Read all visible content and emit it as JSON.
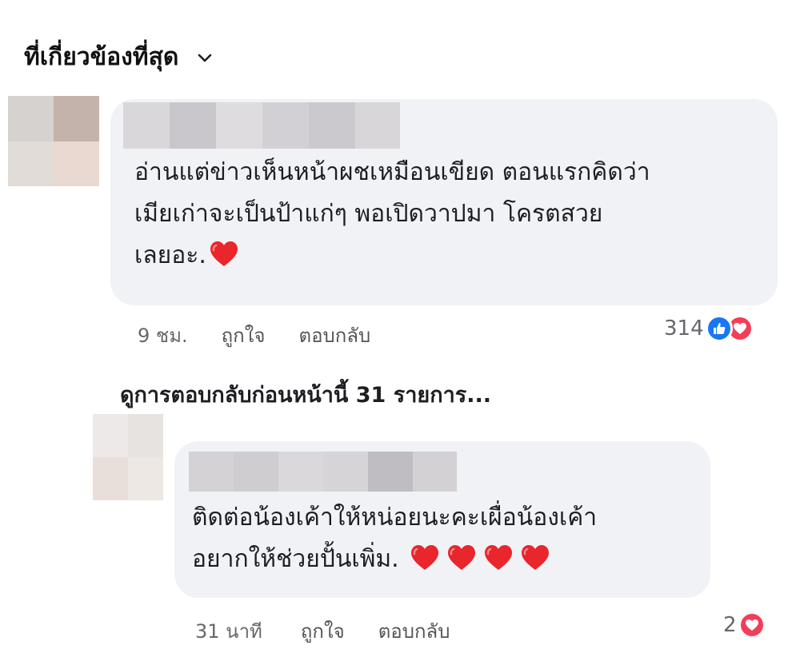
{
  "sort": {
    "label": "ที่เกี่ยวข้องที่สุด",
    "icon": "chevron-down-icon"
  },
  "comments": [
    {
      "text_lines": [
        "อ่านแต่ข่าวเห็นหน้าผชเหมือนเขียด ตอนแรกคิดว่า",
        "เมียเก่าจะเป็นป้าแก่ๆ พอเปิดวาปมา โครตสวย",
        "เลยอะ."
      ],
      "emoji": [
        "heart"
      ],
      "time": "9 ชม.",
      "like_label": "ถูกใจ",
      "reply_label": "ตอบกลับ",
      "reaction_count": "314",
      "reactions": [
        "like-icon",
        "love-icon"
      ]
    }
  ],
  "view_previous_replies": "ดูการตอบกลับก่อนหน้านี้ 31 รายการ...",
  "replies": [
    {
      "text_lines": [
        "ติดต่อน้องเค้าให้หน่อยนะคะเผื่อน้องเค้า",
        "อยากให้ช่วยปั้นเพิ่ม."
      ],
      "emoji": [
        "heart",
        "heart",
        "heart",
        "heart"
      ],
      "time": "31 นาที",
      "like_label": "ถูกใจ",
      "reply_label": "ตอบกลับ",
      "reaction_count": "2",
      "reactions": [
        "love-icon"
      ]
    }
  ],
  "colors": {
    "bubble": "#f0f2f5",
    "like_blue": "#1877f2",
    "love_red": "#f33e58",
    "meta_gray": "#65676b"
  }
}
